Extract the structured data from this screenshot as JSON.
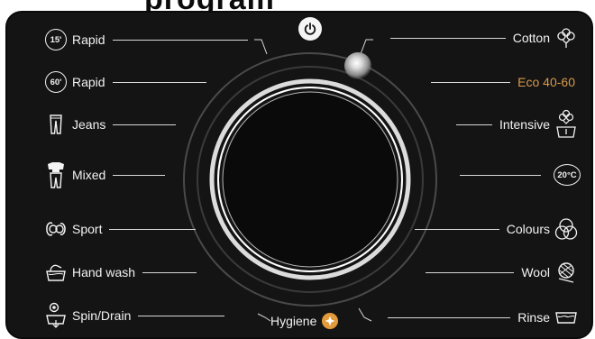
{
  "header": {
    "text": "program"
  },
  "power": {
    "icon": "power-icon"
  },
  "left_programs": [
    {
      "label": "Rapid",
      "icon": "badge",
      "badge_text": "15'"
    },
    {
      "label": "Rapid",
      "icon": "badge",
      "badge_text": "60'"
    },
    {
      "label": "Jeans",
      "icon": "jeans-icon"
    },
    {
      "label": "Mixed",
      "icon": "mixed-clothes-icon"
    },
    {
      "label": "Sport",
      "icon": "sport-icon"
    },
    {
      "label": "Hand wash",
      "icon": "hand-wash-icon"
    },
    {
      "label": "Spin/Drain",
      "icon": "spin-drain-icon"
    }
  ],
  "right_programs": [
    {
      "label": "Cotton",
      "icon": "cotton-flower-icon"
    },
    {
      "label": "Eco 40-60",
      "icon": "none",
      "active": true
    },
    {
      "label": "Intensive",
      "icon": "intensive-icon"
    },
    {
      "label": "",
      "icon": "badge",
      "badge_text": "20°C"
    },
    {
      "label": "Colours",
      "icon": "colours-icon"
    },
    {
      "label": "Wool",
      "icon": "wool-icon"
    },
    {
      "label": "Rinse",
      "icon": "rinse-icon"
    }
  ],
  "bottom_program": {
    "label": "Hygiene",
    "icon": "hygiene-icon"
  },
  "colors": {
    "panel": "#141414",
    "text": "#f2f2f2",
    "active": "#d79a4e",
    "hygiene_badge": "#e39a3a"
  }
}
